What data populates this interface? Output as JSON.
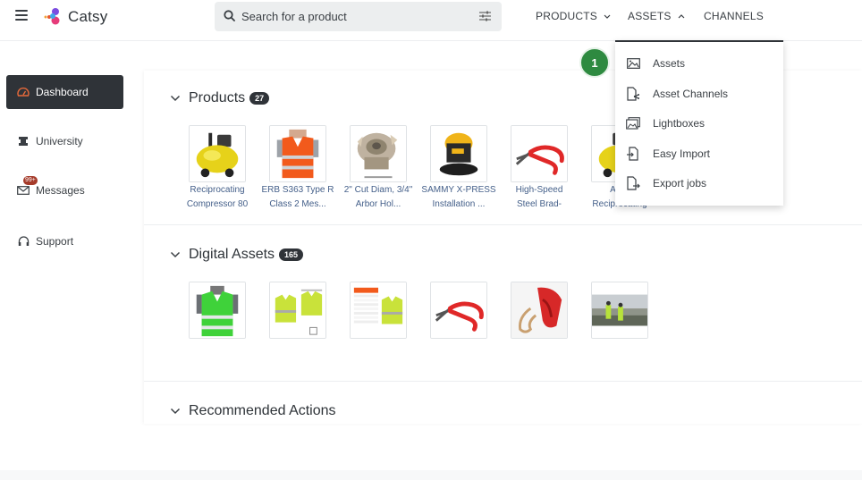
{
  "header": {
    "app_name": "Catsy",
    "search_placeholder": "Search for a product",
    "nav": [
      {
        "label": "PRODUCTS",
        "chevron": "down"
      },
      {
        "label": "ASSETS",
        "chevron": "up"
      },
      {
        "label": "CHANNELS"
      }
    ]
  },
  "sidebar": {
    "items": [
      {
        "label": "Dashboard",
        "icon": "gauge-icon",
        "active": true
      },
      {
        "label": "University",
        "icon": "graduation-cap-icon"
      },
      {
        "label": "Messages",
        "icon": "envelope-icon",
        "badge": "99+"
      },
      {
        "label": "Support",
        "icon": "headset-icon"
      }
    ]
  },
  "products": {
    "title": "Products",
    "count": "27",
    "items": [
      {
        "line1": "Reciprocating",
        "line2": "Compressor 80",
        "icon": "air-compressor-image"
      },
      {
        "line1": "ERB S363 Type R",
        "line2": "Class 2 Mes...",
        "icon": "orange-safety-vest-image"
      },
      {
        "line1": "2\" Cut Diam, 3/4\"",
        "line2": "Arbor Hol...",
        "icon": "milling-cutter-image"
      },
      {
        "line1": "SAMMY X-PRESS",
        "line2": "Installation ...",
        "icon": "orbital-sander-image"
      },
      {
        "line1": "High-Speed",
        "line2": "Steel Brad-",
        "icon": "red-pliers-image"
      },
      {
        "line1": "AirSt",
        "line2": "Reciprocating",
        "icon": "air-compressor-image"
      }
    ]
  },
  "digital_assets": {
    "title": "Digital Assets",
    "count": "165",
    "items": [
      {
        "icon": "green-safety-vest-image"
      },
      {
        "icon": "yellow-vest-drawing-image"
      },
      {
        "icon": "size-chart-image"
      },
      {
        "icon": "red-pliers-image"
      },
      {
        "icon": "red-tool-closeup-image"
      },
      {
        "icon": "workers-field-photo-image"
      }
    ]
  },
  "recommended": {
    "title": "Recommended Actions"
  },
  "assets_menu": {
    "items": [
      {
        "label": "Assets",
        "icon": "image-icon"
      },
      {
        "label": "Asset Channels",
        "icon": "file-share-icon"
      },
      {
        "label": "Lightboxes",
        "icon": "gallery-icon"
      },
      {
        "label": "Easy Import",
        "icon": "file-import-icon"
      },
      {
        "label": "Export jobs",
        "icon": "file-export-icon"
      }
    ]
  },
  "step_badge": "1",
  "colors": {
    "sidebar_active_bg": "#2f3338",
    "link_blue": "#45608a",
    "step_green": "#2e8a40",
    "badge_red": "#a53b2a"
  }
}
